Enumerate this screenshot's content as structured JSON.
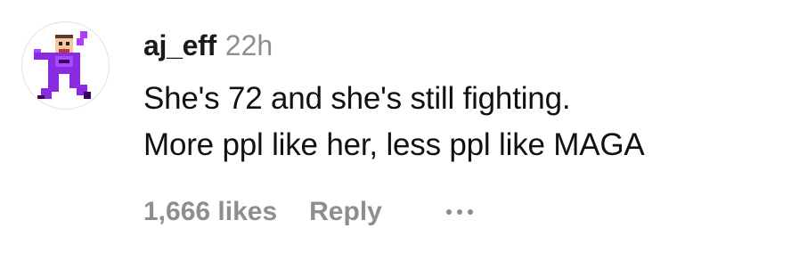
{
  "comment": {
    "avatar_icon": "pixel-character-avatar-icon",
    "username": "aj_eff",
    "timestamp": "22h",
    "text_lines": [
      "She's 72 and she's still fighting.",
      "More ppl like her, less ppl like MAGA"
    ],
    "likes_label": "1,666 likes",
    "reply_label": "Reply",
    "more_icon": "ellipsis-icon"
  },
  "colors": {
    "username": "#1a1a1a",
    "secondary": "#8e8e8e",
    "avatar_body": "#8a2be2",
    "avatar_skin": "#f3c7a1"
  }
}
